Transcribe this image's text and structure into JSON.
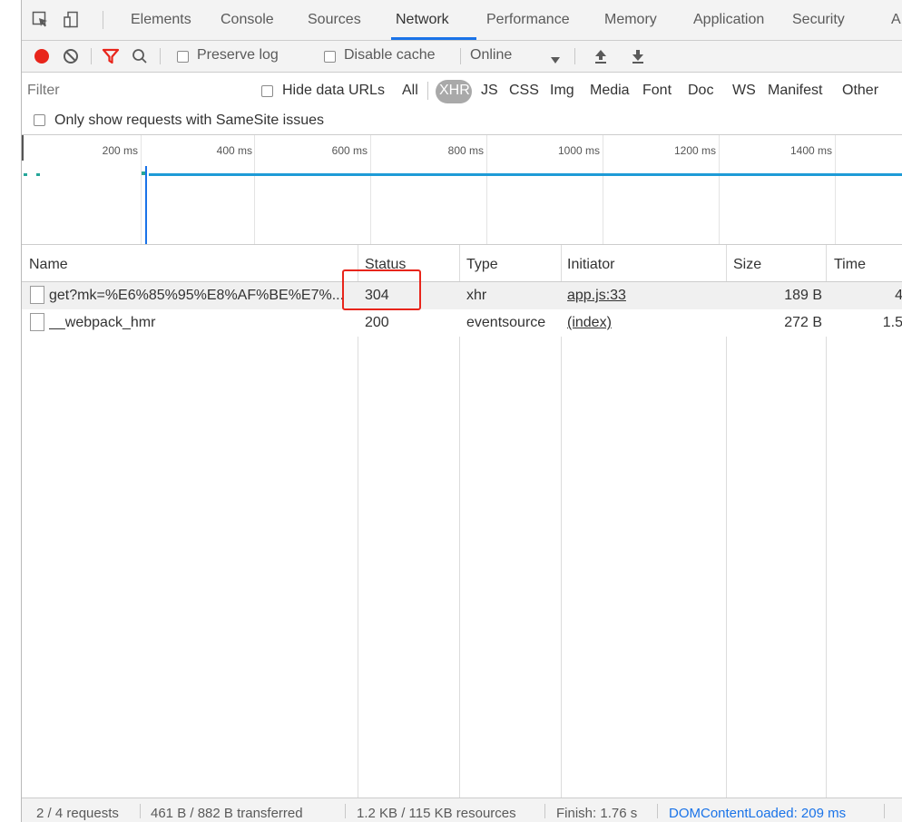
{
  "tabs": {
    "items": [
      "Elements",
      "Console",
      "Sources",
      "Network",
      "Performance",
      "Memory",
      "Application",
      "Security",
      "A"
    ],
    "active": "Network"
  },
  "toolbar": {
    "preserve_log": "Preserve log",
    "disable_cache": "Disable cache",
    "throttling": "Online"
  },
  "filter": {
    "placeholder": "Filter",
    "hide_data_urls": "Hide data URLs",
    "types": [
      "All",
      "XHR",
      "JS",
      "CSS",
      "Img",
      "Media",
      "Font",
      "Doc",
      "WS",
      "Manifest",
      "Other"
    ],
    "active_type": "XHR",
    "samesite": "Only show requests with SameSite issues"
  },
  "overview": {
    "ticks": [
      "200 ms",
      "400 ms",
      "600 ms",
      "800 ms",
      "1000 ms",
      "1200 ms",
      "1400 ms"
    ]
  },
  "table": {
    "columns": [
      "Name",
      "Status",
      "Type",
      "Initiator",
      "Size",
      "Time"
    ],
    "rows": [
      {
        "name": "get?mk=%E6%85%95%E8%AF%BE%E7%...",
        "status": "304",
        "type": "xhr",
        "initiator": "app.js:33",
        "size": "189 B",
        "time": "4"
      },
      {
        "name": "__webpack_hmr",
        "status": "200",
        "type": "eventsource",
        "initiator": "(index)",
        "size": "272 B",
        "time": "1.5"
      }
    ]
  },
  "statusbar": {
    "requests": "2 / 4 requests",
    "transferred": "461 B / 882 B transferred",
    "resources": "1.2 KB / 115 KB resources",
    "finish": "Finish: 1.76 s",
    "dom_loaded": "DOMContentLoaded: 209 ms"
  },
  "colors": {
    "record": "#e8251b",
    "filter_icon": "#e8251b",
    "accent": "#1a73e8",
    "dom_loaded": "#1a73e8",
    "highlight": "#e8251b"
  }
}
